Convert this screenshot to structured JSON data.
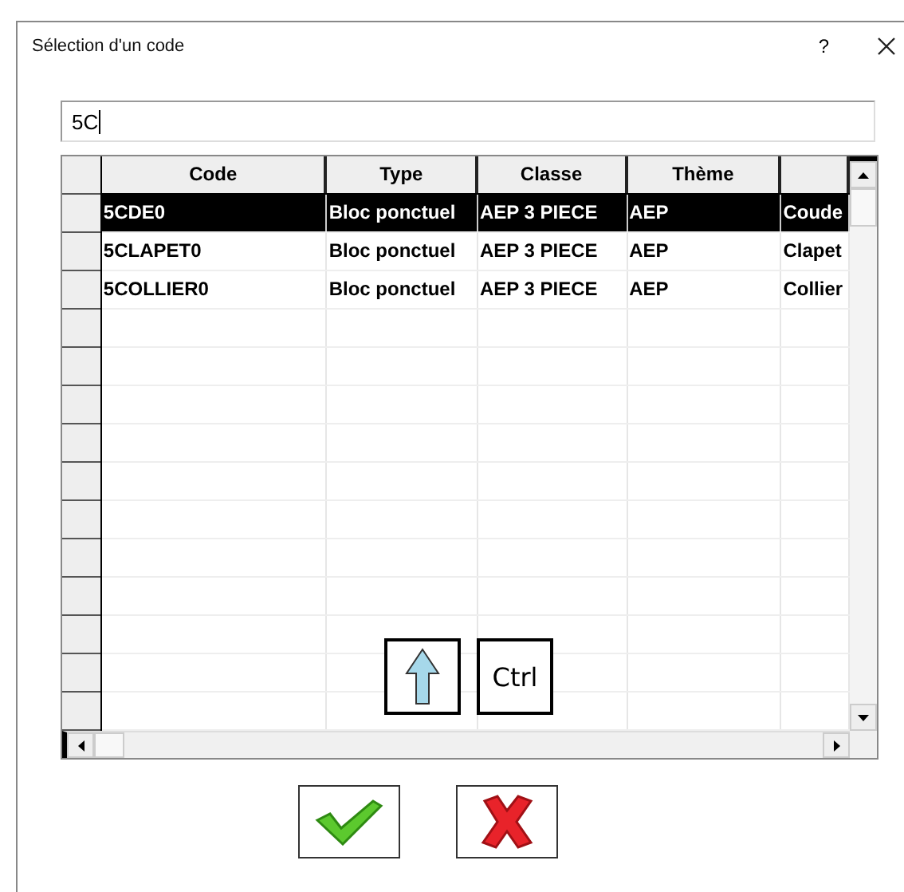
{
  "window": {
    "title": "Sélection d'un code",
    "help": "?"
  },
  "search": {
    "value": "5C"
  },
  "table": {
    "columns": [
      "Code",
      "Type",
      "Classe",
      "Thème",
      ""
    ],
    "rows": [
      {
        "cells": [
          "5CDE0",
          "Bloc ponctuel",
          "AEP 3 PIECE",
          "AEP",
          "Coude"
        ],
        "selected": true
      },
      {
        "cells": [
          "5CLAPET0",
          "Bloc ponctuel",
          "AEP 3 PIECE",
          "AEP",
          "Clapet"
        ],
        "selected": false
      },
      {
        "cells": [
          "5COLLIER0",
          "Bloc ponctuel",
          "AEP 3 PIECE",
          "AEP",
          "Collier"
        ],
        "selected": false
      }
    ]
  },
  "keys": [
    {
      "kind": "shift"
    },
    {
      "kind": "text",
      "label": "Ctrl"
    }
  ],
  "buttons": [
    {
      "kind": "ok"
    },
    {
      "kind": "cancel"
    }
  ]
}
